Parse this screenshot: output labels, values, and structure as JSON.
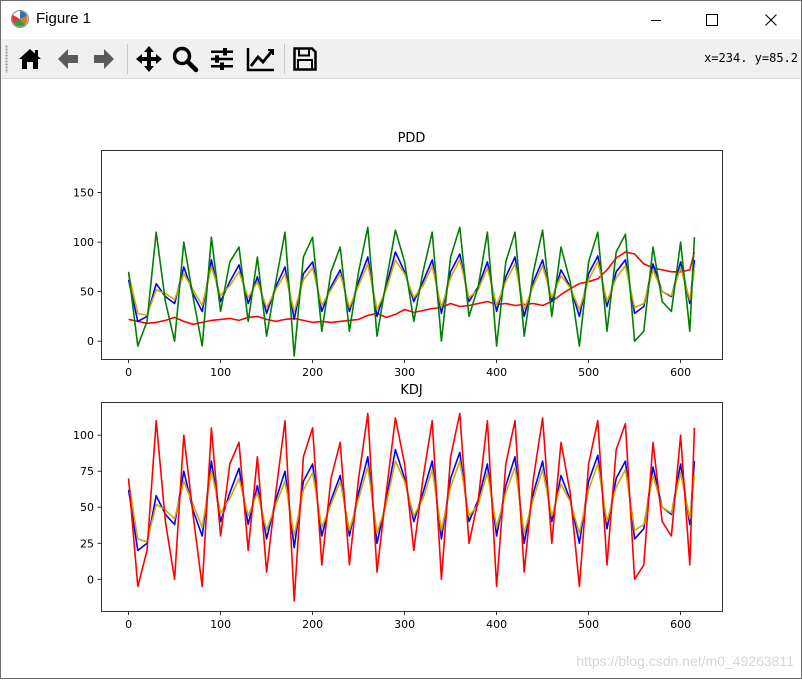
{
  "window": {
    "title": "Figure 1",
    "icon": "matplotlib-icon",
    "controls": [
      "minimize-icon",
      "maximize-icon",
      "close-icon"
    ]
  },
  "toolbar": {
    "buttons": [
      "home-icon",
      "back-arrow-icon",
      "forward-arrow-icon",
      "pan-icon",
      "zoom-icon",
      "subplots-icon",
      "customize-icon",
      "save-icon"
    ],
    "coords": "x=234. y=85.2"
  },
  "watermark": "https://blog.csdn.net/m0_49263811",
  "chart_data": [
    {
      "type": "line",
      "title": "PDD",
      "xlabel": "",
      "ylabel": "",
      "xlim": [
        -30,
        645
      ],
      "ylim": [
        -18,
        193
      ],
      "xticks": [
        0,
        100,
        200,
        300,
        400,
        500,
        600
      ],
      "yticks": [
        0,
        50,
        100,
        150
      ],
      "grid": false,
      "legend": false,
      "x": [
        0,
        10,
        20,
        30,
        40,
        50,
        60,
        70,
        80,
        90,
        100,
        110,
        120,
        130,
        140,
        150,
        160,
        170,
        180,
        190,
        200,
        210,
        220,
        230,
        240,
        250,
        260,
        270,
        280,
        290,
        300,
        310,
        320,
        330,
        340,
        350,
        360,
        370,
        380,
        390,
        400,
        410,
        420,
        430,
        440,
        450,
        460,
        470,
        480,
        490,
        500,
        510,
        520,
        530,
        540,
        550,
        560,
        570,
        580,
        590,
        600,
        610,
        615
      ],
      "series": [
        {
          "color": "#ff0000",
          "values": [
            22,
            20,
            18,
            19,
            21,
            24,
            20,
            17,
            19,
            21,
            22,
            23,
            21,
            24,
            25,
            22,
            20,
            22,
            23,
            21,
            19,
            20,
            19,
            20,
            21,
            22,
            26,
            28,
            24,
            27,
            32,
            29,
            31,
            33,
            34,
            38,
            35,
            36,
            38,
            40,
            37,
            38,
            36,
            37,
            38,
            36,
            40,
            47,
            53,
            58,
            60,
            63,
            72,
            84,
            90,
            88,
            78,
            74,
            72,
            70,
            70,
            72,
            90
          ]
        },
        {
          "color": "#0000ff",
          "values": [
            62,
            20,
            25,
            58,
            45,
            38,
            75,
            48,
            30,
            82,
            40,
            60,
            77,
            38,
            65,
            28,
            55,
            75,
            22,
            68,
            80,
            30,
            55,
            72,
            30,
            60,
            85,
            25,
            55,
            90,
            70,
            40,
            60,
            82,
            28,
            70,
            88,
            40,
            55,
            80,
            30,
            65,
            85,
            25,
            60,
            82,
            40,
            72,
            55,
            25,
            68,
            86,
            35,
            70,
            82,
            28,
            35,
            78,
            50,
            45,
            80,
            38,
            82
          ]
        },
        {
          "color": "#d4aa00",
          "values": [
            68,
            28,
            26,
            52,
            48,
            42,
            68,
            52,
            36,
            75,
            46,
            56,
            70,
            44,
            60,
            34,
            52,
            68,
            30,
            62,
            74,
            36,
            52,
            68,
            34,
            56,
            78,
            32,
            52,
            82,
            68,
            44,
            56,
            76,
            34,
            64,
            82,
            44,
            52,
            74,
            36,
            60,
            78,
            32,
            56,
            76,
            44,
            66,
            54,
            32,
            62,
            80,
            40,
            64,
            76,
            34,
            38,
            72,
            50,
            46,
            74,
            42,
            72
          ]
        },
        {
          "color": "#008000",
          "values": [
            70,
            -5,
            20,
            110,
            40,
            0,
            100,
            45,
            -5,
            105,
            30,
            80,
            95,
            20,
            85,
            5,
            60,
            110,
            -15,
            85,
            105,
            10,
            70,
            95,
            10,
            70,
            115,
            5,
            60,
            112,
            80,
            20,
            70,
            110,
            0,
            85,
            115,
            25,
            55,
            110,
            -5,
            80,
            110,
            5,
            70,
            112,
            25,
            95,
            60,
            -5,
            80,
            110,
            10,
            90,
            108,
            0,
            10,
            95,
            40,
            30,
            100,
            10,
            105
          ]
        }
      ]
    },
    {
      "type": "line",
      "title": "KDJ",
      "xlabel": "",
      "ylabel": "",
      "xlim": [
        -30,
        645
      ],
      "ylim": [
        -22,
        123
      ],
      "xticks": [
        0,
        100,
        200,
        300,
        400,
        500,
        600
      ],
      "yticks": [
        0,
        25,
        50,
        75,
        100
      ],
      "grid": false,
      "legend": false,
      "x": [
        0,
        10,
        20,
        30,
        40,
        50,
        60,
        70,
        80,
        90,
        100,
        110,
        120,
        130,
        140,
        150,
        160,
        170,
        180,
        190,
        200,
        210,
        220,
        230,
        240,
        250,
        260,
        270,
        280,
        290,
        300,
        310,
        320,
        330,
        340,
        350,
        360,
        370,
        380,
        390,
        400,
        410,
        420,
        430,
        440,
        450,
        460,
        470,
        480,
        490,
        500,
        510,
        520,
        530,
        540,
        550,
        560,
        570,
        580,
        590,
        600,
        610,
        615
      ],
      "series": [
        {
          "color": "#0000ff",
          "values": [
            62,
            20,
            25,
            58,
            45,
            38,
            75,
            48,
            30,
            82,
            40,
            60,
            77,
            38,
            65,
            28,
            55,
            75,
            22,
            68,
            80,
            30,
            55,
            72,
            30,
            60,
            85,
            25,
            55,
            90,
            70,
            40,
            60,
            82,
            28,
            70,
            88,
            40,
            55,
            80,
            30,
            65,
            85,
            25,
            60,
            82,
            40,
            72,
            55,
            25,
            68,
            86,
            35,
            70,
            82,
            28,
            35,
            78,
            50,
            45,
            80,
            38,
            82
          ]
        },
        {
          "color": "#d4aa00",
          "values": [
            68,
            28,
            26,
            52,
            48,
            42,
            68,
            52,
            36,
            75,
            46,
            56,
            70,
            44,
            60,
            34,
            52,
            68,
            30,
            62,
            74,
            36,
            52,
            68,
            34,
            56,
            78,
            32,
            52,
            82,
            68,
            44,
            56,
            76,
            34,
            64,
            82,
            44,
            52,
            74,
            36,
            60,
            78,
            32,
            56,
            76,
            44,
            66,
            54,
            32,
            62,
            80,
            40,
            64,
            76,
            34,
            38,
            72,
            50,
            46,
            74,
            42,
            72
          ]
        },
        {
          "color": "#ff0000",
          "values": [
            70,
            -5,
            20,
            110,
            40,
            0,
            100,
            45,
            -5,
            105,
            30,
            80,
            95,
            20,
            85,
            5,
            60,
            110,
            -15,
            85,
            105,
            10,
            70,
            95,
            10,
            70,
            115,
            5,
            60,
            112,
            80,
            20,
            70,
            110,
            0,
            85,
            115,
            25,
            55,
            110,
            -5,
            80,
            110,
            5,
            70,
            112,
            25,
            95,
            60,
            -5,
            80,
            110,
            10,
            90,
            108,
            0,
            10,
            95,
            40,
            30,
            100,
            10,
            105
          ]
        }
      ]
    }
  ]
}
